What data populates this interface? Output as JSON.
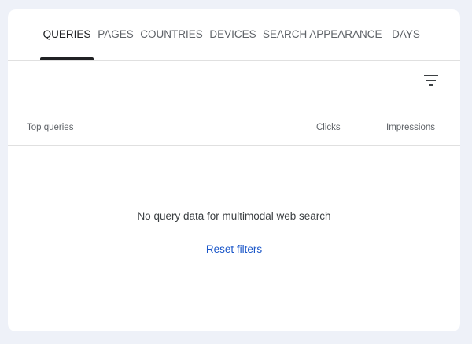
{
  "tabs": [
    {
      "label": "QUERIES",
      "active": true
    },
    {
      "label": "PAGES",
      "active": false
    },
    {
      "label": "COUNTRIES",
      "active": false
    },
    {
      "label": "DEVICES",
      "active": false
    },
    {
      "label": "SEARCH APPEARANCE",
      "active": false
    },
    {
      "label": "DAYS",
      "active": false
    }
  ],
  "toolbar": {
    "filter_icon": "filter-list-icon"
  },
  "table": {
    "columns": [
      "Top queries",
      "Clicks",
      "Impressions"
    ]
  },
  "empty_state": {
    "message": "No query data for multimodal web search",
    "reset_label": "Reset filters"
  },
  "colors": {
    "page_background": "#eef1f8",
    "card_background": "#ffffff",
    "link": "#1a56c8",
    "active_tab": "#202124",
    "inactive_tab": "#5f6368"
  }
}
